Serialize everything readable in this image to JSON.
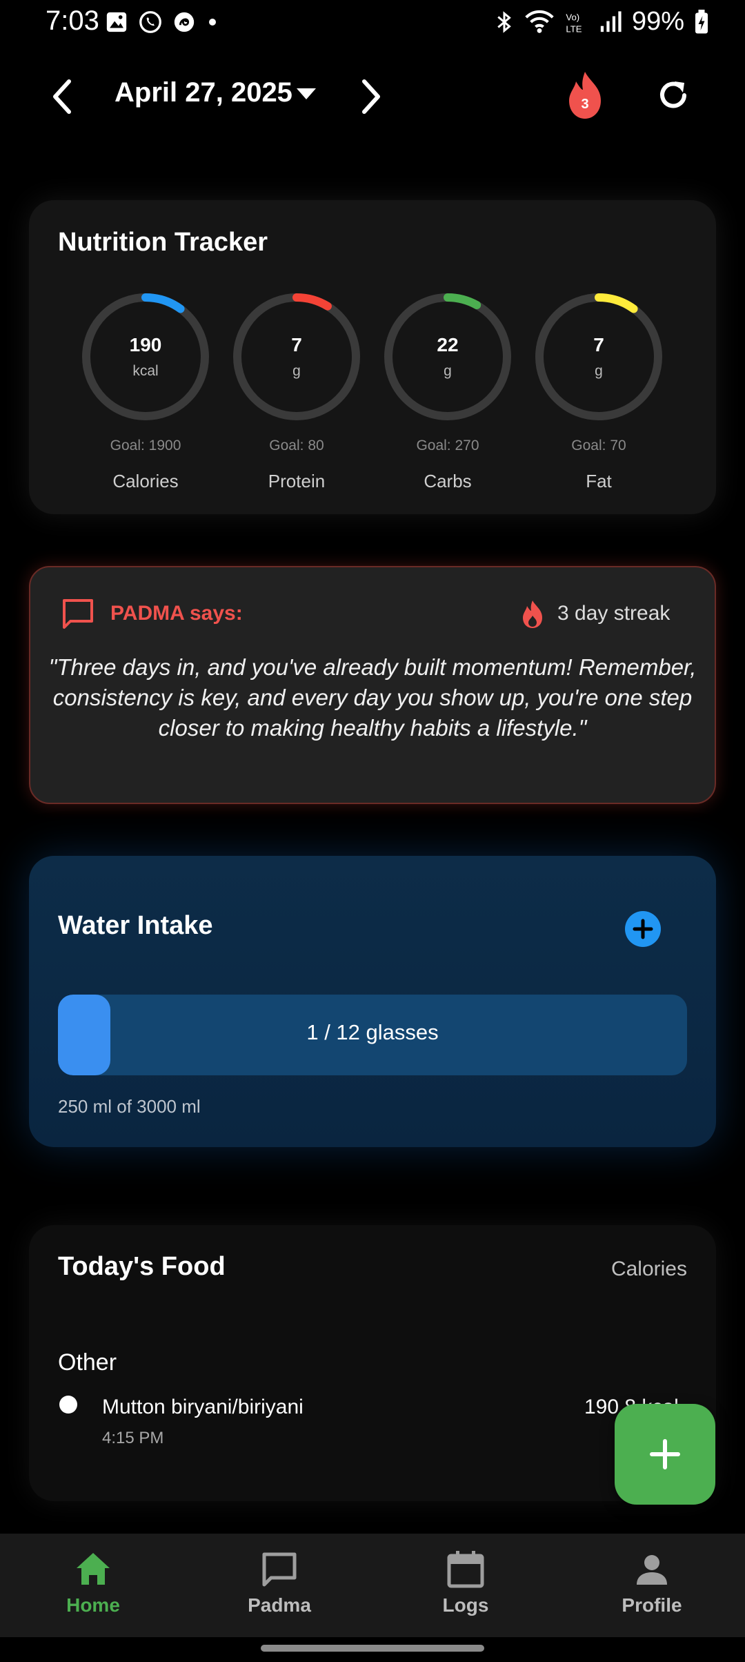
{
  "status_bar": {
    "time": "7:03",
    "battery": "99%"
  },
  "header": {
    "date": "April 27, 2025",
    "streak_badge": "3"
  },
  "nutrition": {
    "title": "Nutrition Tracker",
    "rings": [
      {
        "value": "190",
        "unit": "kcal",
        "goal": "Goal: 1900",
        "label": "Calories",
        "progress": 0.1,
        "color": "#2196f3"
      },
      {
        "value": "7",
        "unit": "g",
        "goal": "Goal: 80",
        "label": "Protein",
        "progress": 0.0875,
        "color": "#f44336"
      },
      {
        "value": "22",
        "unit": "g",
        "goal": "Goal: 270",
        "label": "Carbs",
        "progress": 0.0815,
        "color": "#4caf50"
      },
      {
        "value": "7",
        "unit": "g",
        "goal": "Goal: 70",
        "label": "Fat",
        "progress": 0.1,
        "color": "#ffeb3b"
      }
    ]
  },
  "padma": {
    "title": "PADMA says:",
    "streak": "3 day streak",
    "quote": "\"Three days in, and you've already built momentum! Remember, consistency is key, and every day you show up, you're one step closer to making healthy habits a lifestyle.\""
  },
  "water": {
    "title": "Water Intake",
    "bar_text": "1 / 12 glasses",
    "progress": 0.0833,
    "subtitle": "250 ml of 3000 ml"
  },
  "food": {
    "title": "Today's Food",
    "column_label": "Calories",
    "section": "Other",
    "items": [
      {
        "name": "Mutton biryani/biriyani",
        "time": "4:15 PM",
        "calories": "190.8 kcal"
      }
    ]
  },
  "nav": {
    "items": [
      {
        "label": "Home",
        "active": true
      },
      {
        "label": "Padma",
        "active": false
      },
      {
        "label": "Logs",
        "active": false
      },
      {
        "label": "Profile",
        "active": false
      }
    ]
  },
  "colors": {
    "accent_green": "#4caf50",
    "padma_red": "#f0524d",
    "water_blue": "#2196f3"
  }
}
